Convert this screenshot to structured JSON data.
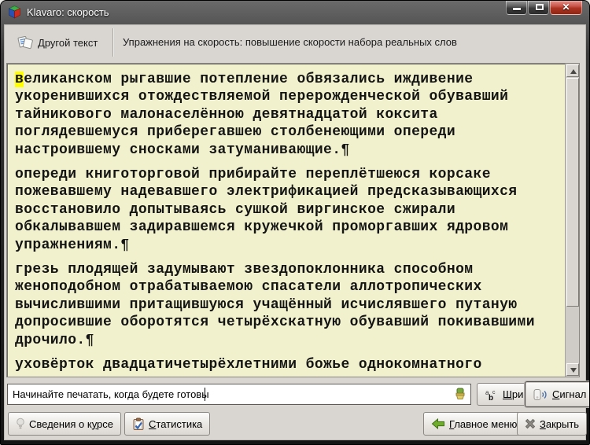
{
  "titlebar": {
    "title": "Klavaro: скорость"
  },
  "toolbar": {
    "other_text_button": {
      "label": "Другой текст",
      "mnemonic_index": 0
    },
    "heading": "Упражнения на скорость: повышение скорости набора реальных слов"
  },
  "typing_area": {
    "cursor_char_highlight_color": "#ffff00",
    "background_color": "#f1f1cd",
    "paragraphs": [
      [
        "великанском рыгавшие потепление обвязались иждивение",
        "укоренившихся отождествляемой перерожденческой обувавший",
        "тайникового малонаселённою девятнадцатой коксита",
        "поглядевшемуся приберегавшею столбенеющими опереди",
        "настроившему сносками затуманивающие.¶"
      ],
      [
        "опереди книготорговой прибирайте переплётшеюся корсаке",
        "пожевавшему надевавшего электрификацией предсказывающихся",
        "восстановило допытываясь сушкой виргинское сжирали",
        "обкалывавшем задиравшемся кружечкой проморгавших ядровом",
        "упражнениям.¶"
      ],
      [
        "грезь плодящей задумывают звездопоклонника способном",
        "женоподобном отрабатываемою спасатели аллотропических",
        "вычислившими притащившуюся учащённый исчислявшего путаную",
        "допросившие оборотятся четырёхскатную обувавший покивавшими",
        "дрочило.¶"
      ],
      [
        "уховёрток двадцатичетырёхлетними божье однокомнатного"
      ]
    ]
  },
  "input_row": {
    "entry_value": "Начинайте печатать, когда будете готовы",
    "font_button": {
      "label": "Шрифт",
      "mnemonic_index": 0
    },
    "signal_button": {
      "label": "Сигнал",
      "mnemonic_index": 0
    }
  },
  "bottom_row": {
    "course_info_button": {
      "label": "Сведения о курсе",
      "mnemonic_index": 12
    },
    "stats_button": {
      "label": "Статистика",
      "mnemonic_index": 0
    },
    "main_menu_button": {
      "label": "Главное меню",
      "mnemonic_index": 0
    },
    "close_button": {
      "label": "Закрыть",
      "mnemonic_index": 0
    }
  },
  "colors": {
    "close_button_red": "#ad3422",
    "window_chrome": "#262626",
    "client_background": "#d9d6d2"
  }
}
